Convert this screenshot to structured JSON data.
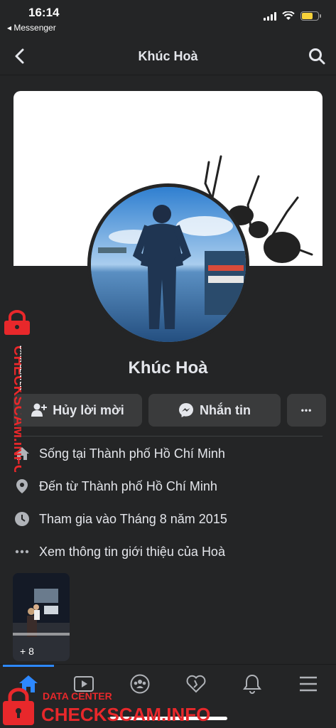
{
  "status_bar": {
    "time": "16:14",
    "back_app": "◂ Messenger"
  },
  "nav": {
    "title": "Khúc Hoà"
  },
  "profile": {
    "name": "Khúc Hoà"
  },
  "actions": {
    "cancel_request": "Hủy lời mời",
    "message": "Nhắn tin",
    "more": "•••"
  },
  "info": {
    "lives_prefix": "Sống tại ",
    "lives_place": "Thành phố Hồ Chí Minh",
    "from_prefix": "Đến từ ",
    "from_place": "Thành phố Hồ Chí Minh",
    "joined": "Tham gia vào Tháng 8 năm 2015",
    "see_about": "Xem thông tin giới thiệu của Hoà"
  },
  "photos": {
    "count_label": "+ 8"
  },
  "watermark": {
    "brand": "CHECKSCAM.INFO",
    "sub": "DATA CENTER"
  },
  "colors": {
    "background": "#242526",
    "button": "#3a3b3c",
    "accent": "#2d88ff",
    "watermark": "#e8282b"
  },
  "icons": [
    "back-icon",
    "search-icon",
    "add-friend-icon",
    "messenger-icon",
    "home-icon",
    "video-icon",
    "groups-icon",
    "dating-icon",
    "notifications-icon",
    "menu-icon"
  ]
}
